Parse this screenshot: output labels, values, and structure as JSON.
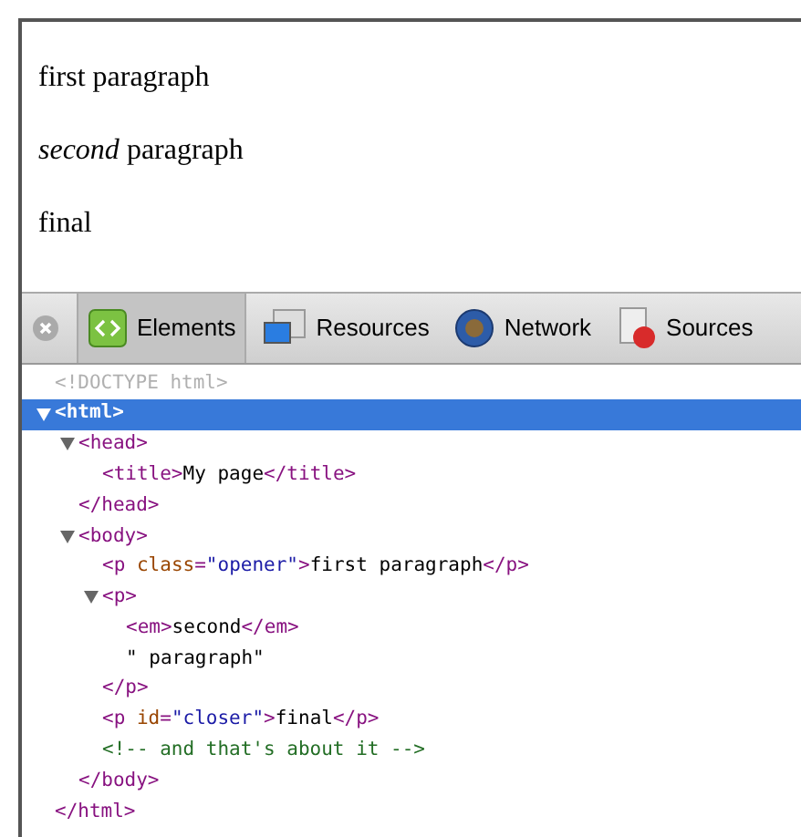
{
  "page": {
    "paragraphs": [
      "first paragraph",
      "*second* paragraph",
      "final"
    ]
  },
  "toolbar": {
    "tabs": [
      {
        "label": "Elements",
        "selected": true
      },
      {
        "label": "Resources",
        "selected": false
      },
      {
        "label": "Network",
        "selected": false
      },
      {
        "label": "Sources",
        "selected": false
      }
    ]
  },
  "dom_tree": [
    {
      "kind": "leaf",
      "selected": false,
      "parts": [
        {
          "kind": "doctype",
          "text": "<!DOCTYPE html>"
        }
      ]
    },
    {
      "kind": "parent",
      "expanded": true,
      "selected": true,
      "parts": [
        {
          "kind": "tag",
          "text": "<html>"
        }
      ],
      "closing": [
        {
          "kind": "tag",
          "text": "</html>"
        }
      ],
      "children": [
        {
          "kind": "parent",
          "expanded": true,
          "selected": false,
          "parts": [
            {
              "kind": "tag",
              "text": "<head>"
            }
          ],
          "closing": [
            {
              "kind": "tag",
              "text": "</head>"
            }
          ],
          "children": [
            {
              "kind": "leaf",
              "selected": false,
              "parts": [
                {
                  "kind": "tag",
                  "text": "<title>"
                },
                {
                  "kind": "text",
                  "text": "My page"
                },
                {
                  "kind": "tag",
                  "text": "</title>"
                }
              ]
            }
          ]
        },
        {
          "kind": "parent",
          "expanded": true,
          "selected": false,
          "parts": [
            {
              "kind": "tag",
              "text": "<body>"
            }
          ],
          "closing": [
            {
              "kind": "tag",
              "text": "</body>"
            }
          ],
          "children": [
            {
              "kind": "leaf",
              "selected": false,
              "parts": [
                {
                  "kind": "tag",
                  "text": "<p"
                },
                {
                  "kind": "attr",
                  "text": " class"
                },
                {
                  "kind": "tag",
                  "text": "="
                },
                {
                  "kind": "value",
                  "text": "\"opener\""
                },
                {
                  "kind": "tag",
                  "text": ">"
                },
                {
                  "kind": "text",
                  "text": "first paragraph"
                },
                {
                  "kind": "tag",
                  "text": "</p>"
                }
              ]
            },
            {
              "kind": "parent",
              "expanded": true,
              "selected": false,
              "parts": [
                {
                  "kind": "tag",
                  "text": "<p>"
                }
              ],
              "closing": [
                {
                  "kind": "tag",
                  "text": "</p>"
                }
              ],
              "children": [
                {
                  "kind": "leaf",
                  "selected": false,
                  "parts": [
                    {
                      "kind": "tag",
                      "text": "<em>"
                    },
                    {
                      "kind": "text",
                      "text": "second"
                    },
                    {
                      "kind": "tag",
                      "text": "</em>"
                    }
                  ]
                },
                {
                  "kind": "leaf",
                  "selected": false,
                  "parts": [
                    {
                      "kind": "text",
                      "text": "\" paragraph\""
                    }
                  ]
                }
              ]
            },
            {
              "kind": "leaf",
              "selected": false,
              "parts": [
                {
                  "kind": "tag",
                  "text": "<p"
                },
                {
                  "kind": "attr",
                  "text": " id"
                },
                {
                  "kind": "tag",
                  "text": "="
                },
                {
                  "kind": "value",
                  "text": "\"closer\""
                },
                {
                  "kind": "tag",
                  "text": ">"
                },
                {
                  "kind": "text",
                  "text": "final"
                },
                {
                  "kind": "tag",
                  "text": "</p>"
                }
              ]
            },
            {
              "kind": "leaf",
              "selected": false,
              "parts": [
                {
                  "kind": "comment",
                  "text": "<!-- and that's about it -->"
                }
              ]
            }
          ]
        }
      ]
    }
  ]
}
